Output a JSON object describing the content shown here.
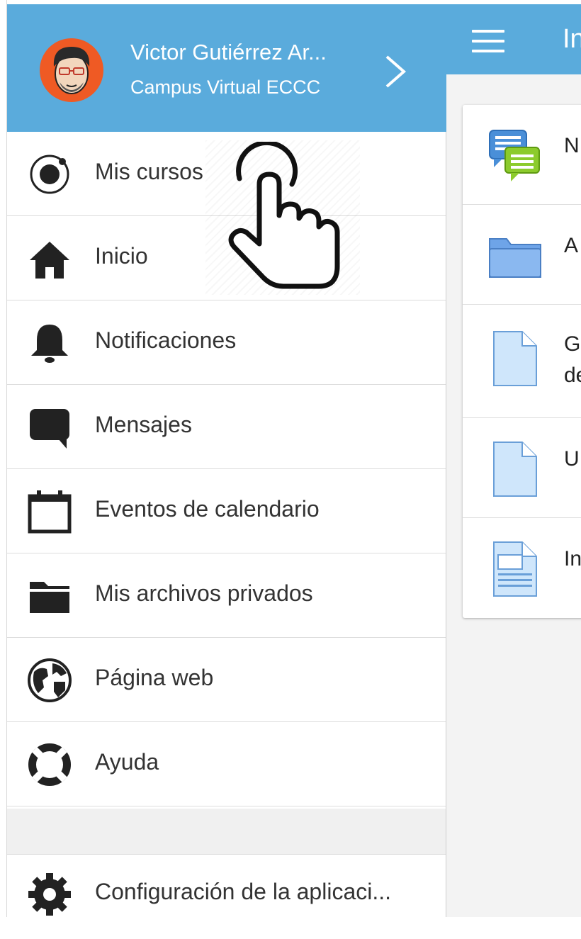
{
  "app_bar": {
    "title": "In"
  },
  "drawer": {
    "header": {
      "user_name": "Victor Gutiérrez Ar...",
      "site_name": "Campus Virtual ECCC"
    },
    "items": [
      {
        "label": "Mis cursos",
        "icon": "courses-icon"
      },
      {
        "label": "Inicio",
        "icon": "home-icon"
      },
      {
        "label": "Notificaciones",
        "icon": "bell-icon"
      },
      {
        "label": "Mensajes",
        "icon": "message-icon"
      },
      {
        "label": "Eventos de calendario",
        "icon": "calendar-icon"
      },
      {
        "label": "Mis archivos privados",
        "icon": "folder-icon"
      },
      {
        "label": "Página web",
        "icon": "globe-icon"
      },
      {
        "label": "Ayuda",
        "icon": "lifebuoy-icon"
      }
    ],
    "footer_item": {
      "label": "Configuración de la aplicaci...",
      "icon": "gear-icon"
    }
  },
  "course_content": {
    "rows": [
      {
        "text": "N",
        "icon": "forum-icon"
      },
      {
        "text": "A",
        "icon": "folder-icon"
      },
      {
        "text_line1": "G",
        "text_line2": "de",
        "icon": "document-icon"
      },
      {
        "text": "U",
        "icon": "document-icon"
      },
      {
        "text": "In",
        "icon": "page-icon"
      }
    ]
  },
  "colors": {
    "primary": "#5aabdc",
    "drawer_bg": "#ffffff",
    "text": "#333333",
    "avatar_bg": "#ef5a24"
  }
}
